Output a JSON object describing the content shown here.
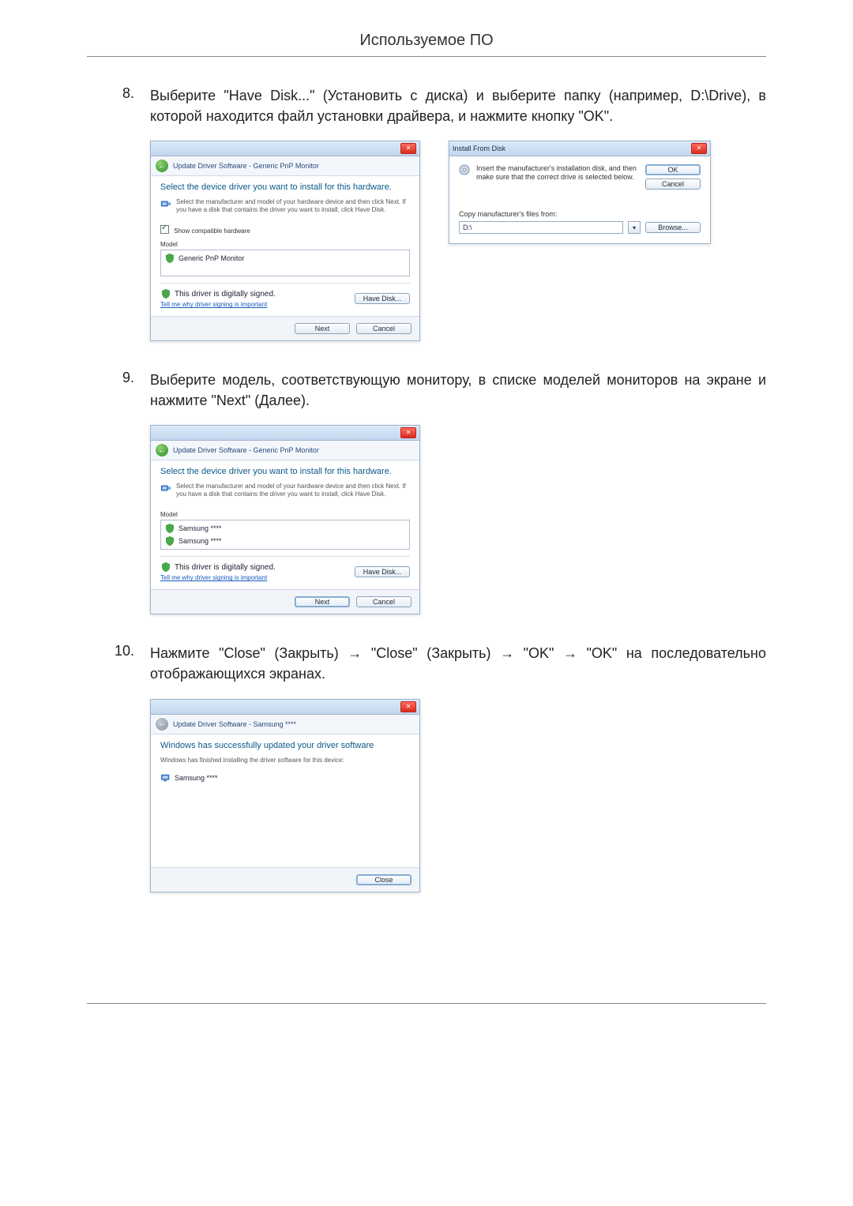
{
  "pageTitle": "Используемое ПО",
  "step8": {
    "num": "8.",
    "text": "Выберите \"Have Disk...\" (Установить с диска) и выберите папку (например, D:\\Drive), в которой находится файл установки драйвера, и нажмите кнопку \"OK\"."
  },
  "step9": {
    "num": "9.",
    "text": "Выберите модель, соответствующую монитору, в списке моделей мониторов на экране и нажмите \"Next\" (Далее)."
  },
  "step10": {
    "num": "10.",
    "text": "Нажмите \"Close\" (Закрыть) → \"Close\" (Закрыть) → \"OK\" → \"OK\" на последовательно отображающихся экранах."
  },
  "dlg1": {
    "nav": "Update Driver Software - Generic PnP Monitor",
    "heading": "Select the device driver you want to install for this hardware.",
    "instr": "Select the manufacturer and model of your hardware device and then click Next. If you have a disk that contains the driver you want to install, click Have Disk.",
    "showCompat": "Show compatible hardware",
    "modelLabel": "Model",
    "model1": "Generic PnP Monitor",
    "signed": "This driver is digitally signed.",
    "signLink": "Tell me why driver signing is important",
    "haveDisk": "Have Disk...",
    "next": "Next",
    "cancel": "Cancel"
  },
  "dlg2": {
    "title": "Install From Disk",
    "instr": "Insert the manufacturer's installation disk, and then make sure that the correct drive is selected below.",
    "ok": "OK",
    "cancel": "Cancel",
    "copyFrom": "Copy manufacturer's files from:",
    "path": "D:\\",
    "browse": "Browse..."
  },
  "dlg3": {
    "nav": "Update Driver Software - Generic PnP Monitor",
    "heading": "Select the device driver you want to install for this hardware.",
    "instr": "Select the manufacturer and model of your hardware device and then click Next. If you have a disk that contains the driver you want to install, click Have Disk.",
    "modelLabel": "Model",
    "model1": "Samsung ****",
    "model2": "Samsung ****",
    "signed": "This driver is digitally signed.",
    "signLink": "Tell me why driver signing is important",
    "haveDisk": "Have Disk...",
    "next": "Next",
    "cancel": "Cancel"
  },
  "dlg4": {
    "nav": "Update Driver Software - Samsung ****",
    "heading": "Windows has successfully updated your driver software",
    "instr": "Windows has finished installing the driver software for this device:",
    "device": "Samsung ****",
    "close": "Close"
  }
}
